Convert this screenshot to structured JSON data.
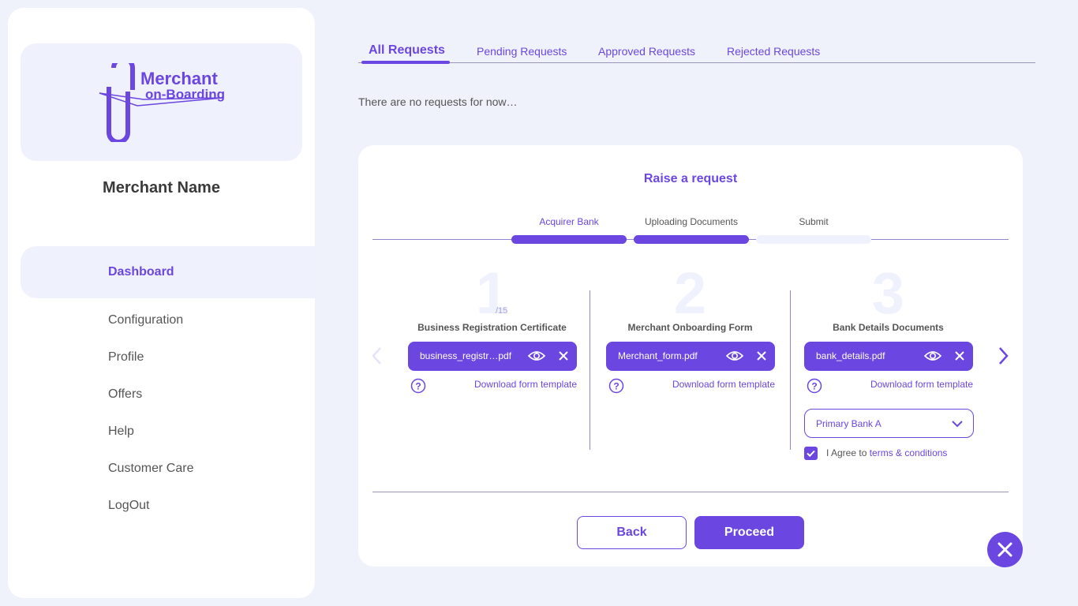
{
  "sidebar": {
    "logo_line1": "Merchant",
    "logo_line2": "on-Boarding",
    "merchant_name": "Merchant Name",
    "active_item": "Dashboard",
    "items": [
      "Configuration",
      "Profile",
      "Offers",
      "Help",
      "Customer Care",
      "LogOut"
    ]
  },
  "tabs": [
    {
      "label": "All Requests",
      "active": true
    },
    {
      "label": "Pending Requests",
      "active": false
    },
    {
      "label": "Approved Requests",
      "active": false
    },
    {
      "label": "Rejected Requests",
      "active": false
    }
  ],
  "empty_message": "There are no requests for now…",
  "card": {
    "title": "Raise a request",
    "steps": [
      {
        "label": "Acquirer Bank",
        "complete": true
      },
      {
        "label": "Uploading Documents",
        "complete": true
      },
      {
        "label": "Submit",
        "complete": false
      }
    ],
    "columns": [
      {
        "number": "1",
        "sub": "/15",
        "title": "Business Registration Certificate",
        "file": "business_registr…pdf",
        "download": "Download form template"
      },
      {
        "number": "2",
        "sub": "",
        "title": "Merchant Onboarding Form",
        "file": "Merchant_form.pdf",
        "download": "Download form template"
      },
      {
        "number": "3",
        "sub": "",
        "title": "Bank Details Documents",
        "file": "bank_details.pdf",
        "download": "Download form template"
      }
    ],
    "bank_select": "Primary Bank A",
    "agree_prefix": "I Agree to ",
    "agree_link": "terms & conditions",
    "agree_checked": true,
    "back_label": "Back",
    "proceed_label": "Proceed"
  },
  "colors": {
    "accent": "#6b46e0",
    "background": "#f0f2fb",
    "pale": "#eff1fc"
  }
}
